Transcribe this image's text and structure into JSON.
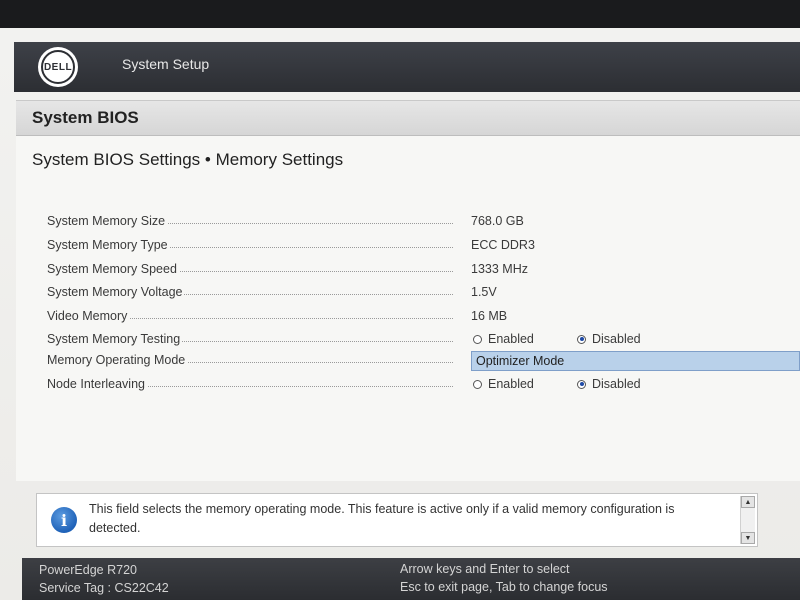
{
  "header": {
    "brand_logo_text": "DELL",
    "app_title": "System Setup"
  },
  "section": {
    "title": "System BIOS",
    "page_heading": "System BIOS Settings • Memory Settings"
  },
  "settings": [
    {
      "label": "System Memory Size",
      "value": "768.0 GB"
    },
    {
      "label": "System Memory Type",
      "value": "ECC DDR3"
    },
    {
      "label": "System Memory Speed",
      "value": "1333 MHz"
    },
    {
      "label": "System Memory Voltage",
      "value": "1.5V"
    },
    {
      "label": "Video Memory",
      "value": "16 MB"
    },
    {
      "label": "System Memory Testing",
      "options": [
        "Enabled",
        "Disabled"
      ],
      "selected": "Disabled"
    },
    {
      "label": "Memory Operating Mode",
      "value": "Optimizer Mode"
    },
    {
      "label": "Node Interleaving",
      "options": [
        "Enabled",
        "Disabled"
      ],
      "selected": "Disabled"
    }
  ],
  "help": {
    "icon": "info-icon",
    "text": "This field selects the memory operating mode. This feature is active only if a valid memory configuration is detected."
  },
  "status_bar": {
    "model": "PowerEdge R720",
    "service_tag": "Service Tag : CS22C42",
    "hint_1": "Arrow keys and Enter to select",
    "hint_2": "Esc to exit page, Tab to change focus"
  },
  "colors": {
    "header_bg": "#2c2e33",
    "selection_bg": "#b9d1ea",
    "radio_selected": "#1f4aa6",
    "info_icon": "#1f62b8"
  }
}
